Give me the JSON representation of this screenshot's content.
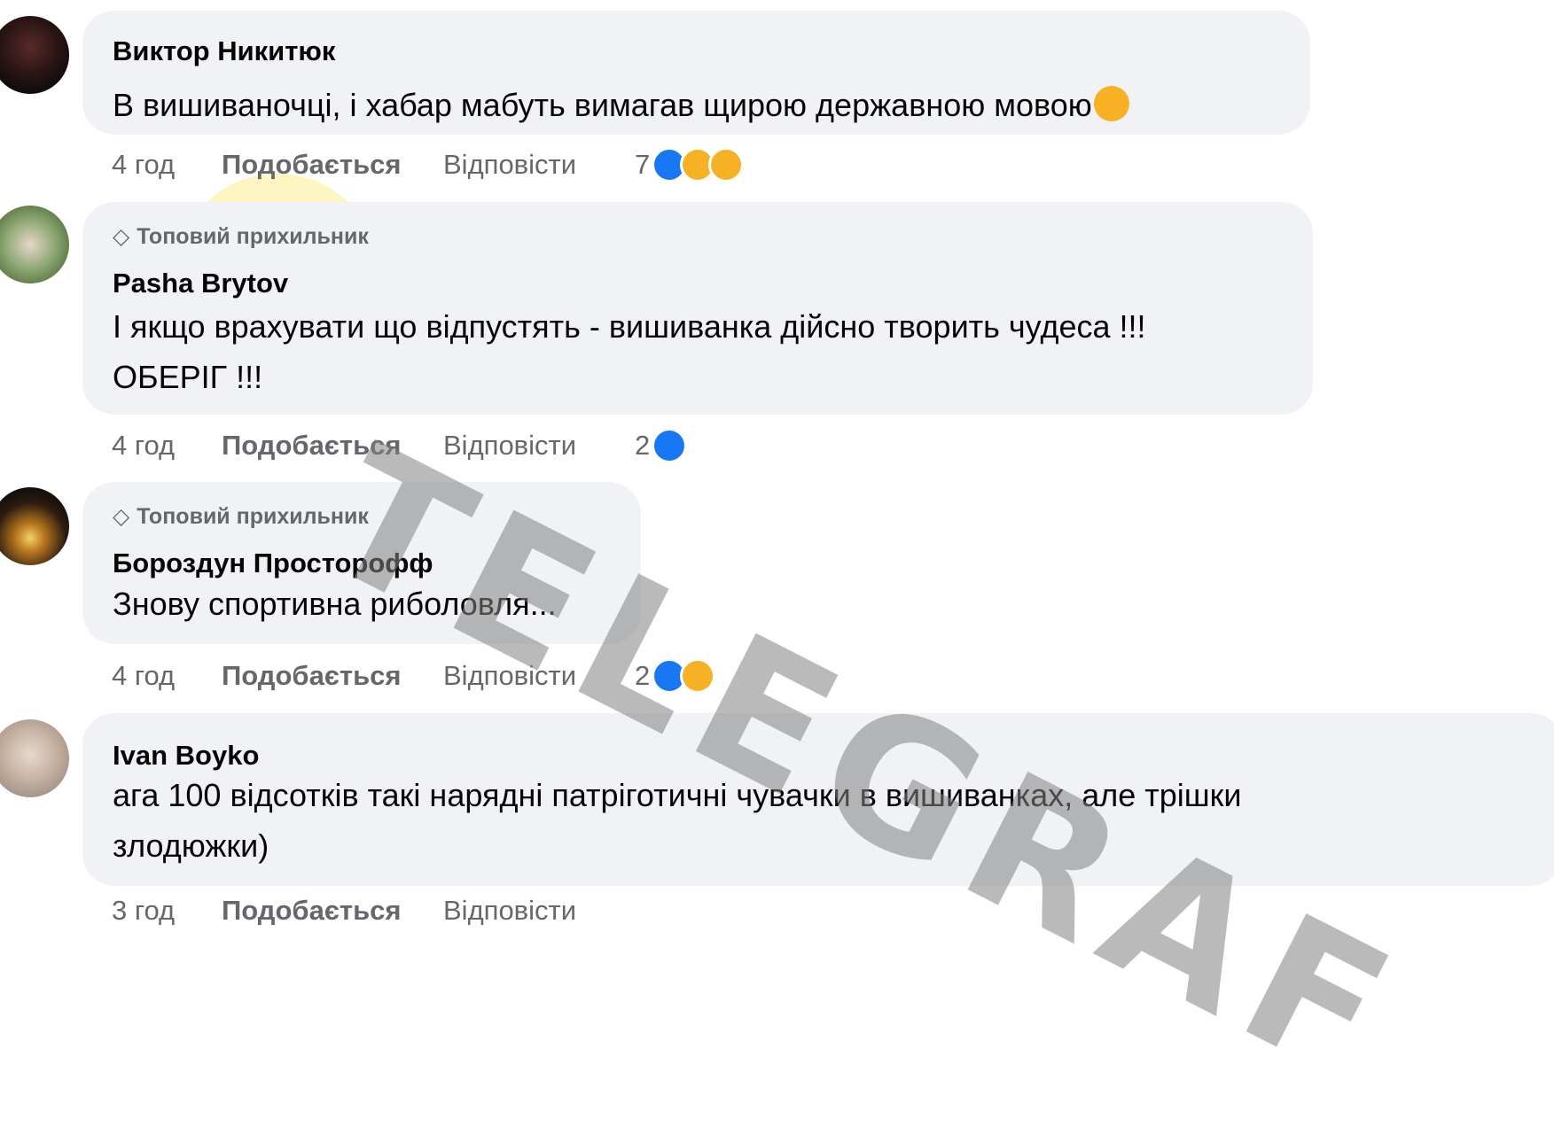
{
  "comments": [
    {
      "author": "Виктор Никитюк",
      "badge": "",
      "text_lines": [
        "В вишиваночці, і хабар мабуть вимагав щирою державною мовою"
      ],
      "time": "4 год",
      "like_label": "Подобається",
      "reply_label": "Відповісти",
      "reaction_count": "7",
      "reactions": [
        "like-icon",
        "haha-icon",
        "sad-icon"
      ]
    },
    {
      "author": "Pasha Brytov",
      "badge": "Топовий прихильник",
      "text_lines": [
        "І якщо врахувати що відпустять - вишиванка дійсно творить чудеса !!!",
        "ОБЕРІГ !!!"
      ],
      "time": "4 год",
      "like_label": "Подобається",
      "reply_label": "Відповісти",
      "reaction_count": "2",
      "reactions": [
        "like-icon"
      ]
    },
    {
      "author": "Бороздун Просторофф",
      "badge": "Топовий прихильник",
      "text_lines": [
        "Знову спортивна риболовля..."
      ],
      "time": "4 год",
      "like_label": "Подобається",
      "reply_label": "Відповісти",
      "reaction_count": "2",
      "reactions": [
        "like-icon",
        "sad-icon"
      ]
    },
    {
      "author": "Ivan Boyko",
      "badge": "",
      "text_lines": [
        "ага 100 відсотків такі нарядні патріготичні чувачки в вишиванках, але трішки",
        "злодюжки)"
      ],
      "time": "3 год",
      "like_label": "Подобається",
      "reply_label": "Відповісти",
      "reaction_count": "",
      "reactions": []
    }
  ],
  "watermark": "TELEGRAF",
  "colors": {
    "bubble": "#f0f2f5",
    "meta_text": "#65676b",
    "like_blue": "#1877f2",
    "emoji_yellow": "#f7b125",
    "watermark_gray": "#828282",
    "logo_yellow": "#fae450"
  }
}
